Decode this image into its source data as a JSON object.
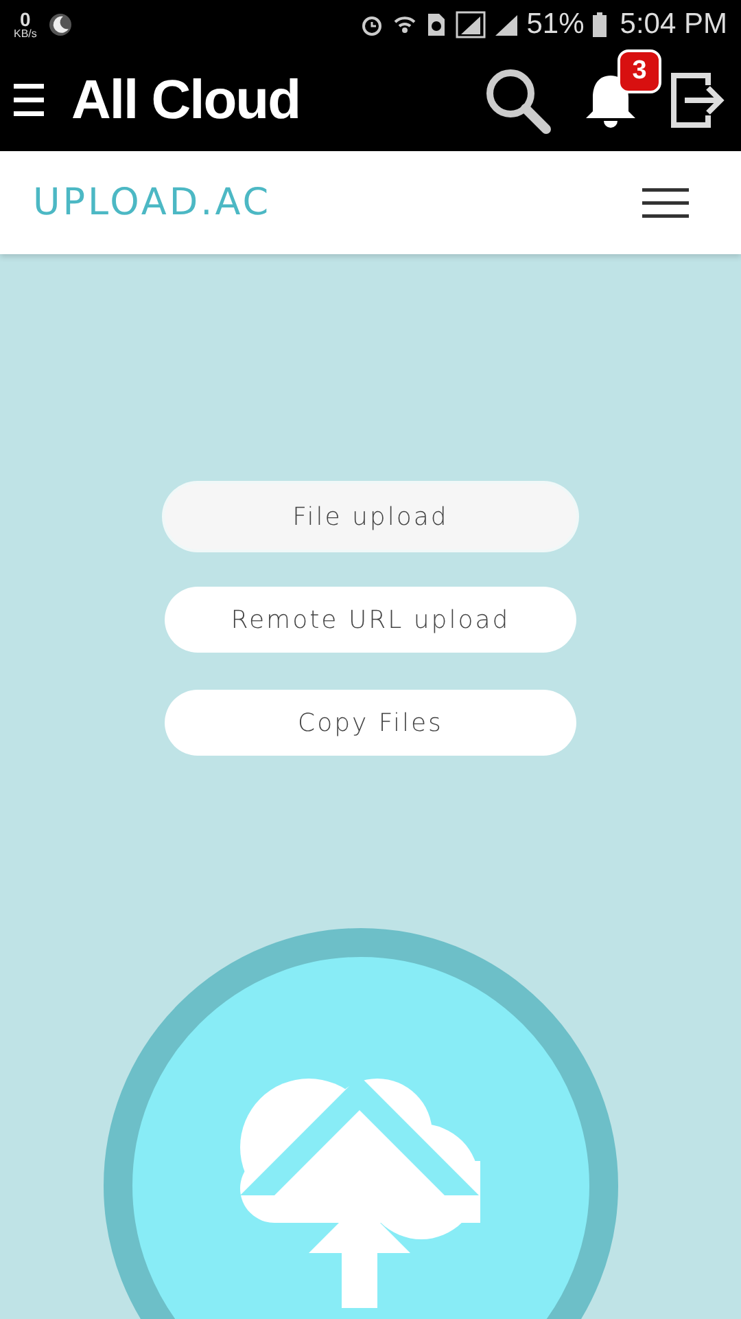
{
  "status_bar": {
    "speed_value": "0",
    "speed_unit": "KB/s",
    "battery": "51%",
    "time": "5:04 PM"
  },
  "app_bar": {
    "title": "All Cloud",
    "notification_count": "3"
  },
  "site_header": {
    "logo": "UPLOAD.AC"
  },
  "buttons": [
    {
      "label": "File upload",
      "selected": true
    },
    {
      "label": "Remote URL upload",
      "selected": false
    },
    {
      "label": "Copy Files",
      "selected": false
    }
  ]
}
